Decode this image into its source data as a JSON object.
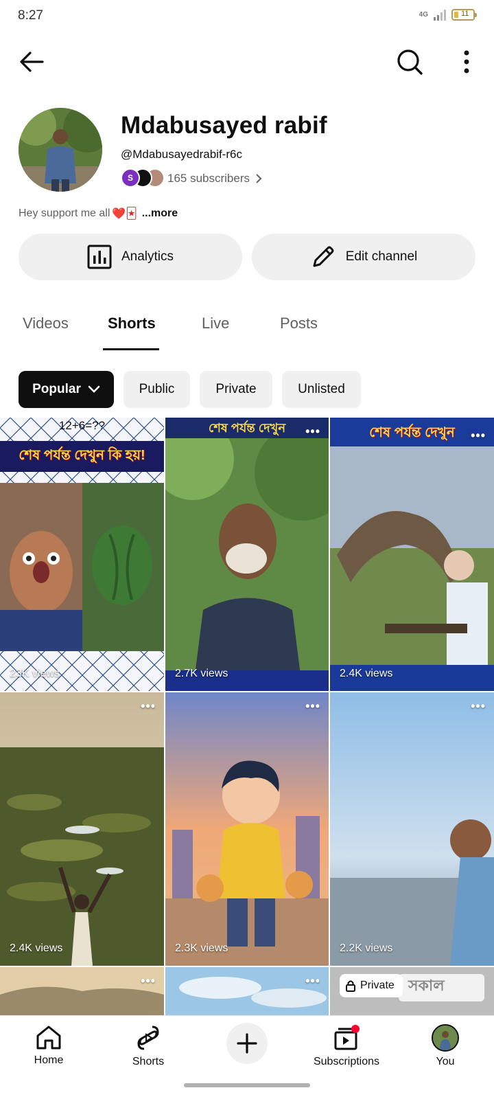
{
  "status_bar": {
    "time": "8:27",
    "network": "4G",
    "battery": "11"
  },
  "header": {
    "back_icon": "arrow-left-icon",
    "search_icon": "search-icon",
    "more_icon": "more-vertical-icon"
  },
  "channel": {
    "name": "Mdabusayed rabif",
    "handle": "@Mdabusayedrabif-r6c",
    "subscribers": "165 subscribers",
    "subscriber_avatar_initial": "S",
    "bio": "Hey support me all",
    "bio_emoji": "❤️🃏",
    "more": "...more"
  },
  "actions": {
    "analytics": "Analytics",
    "edit_channel": "Edit channel"
  },
  "tabs": [
    "Videos",
    "Shorts",
    "Live",
    "Posts"
  ],
  "active_tab": "Shorts",
  "filters": [
    "Popular",
    "Public",
    "Private",
    "Unlisted"
  ],
  "shorts": [
    {
      "views": "23K views",
      "top_text": "12+6=??",
      "banner": "শেষ পর্যন্ত দেখুন কি হয়!"
    },
    {
      "views": "2.7K views",
      "banner": "শেষ পর্যন্ত দেখুন"
    },
    {
      "views": "2.4K views",
      "banner": "শেষ পর্যন্ত দেখুন"
    },
    {
      "views": "2.4K views"
    },
    {
      "views": "2.3K views"
    },
    {
      "views": "2.2K views"
    },
    {
      "views": ""
    },
    {
      "views": ""
    },
    {
      "views": "",
      "private_label": "Private",
      "overlay_text": "সকাল"
    }
  ],
  "bottom_nav": {
    "home": "Home",
    "shorts": "Shorts",
    "subscriptions": "Subscriptions",
    "you": "You"
  },
  "colors": {
    "accent_red": "#ff0033",
    "chip_selected": "#0f0f0f"
  }
}
